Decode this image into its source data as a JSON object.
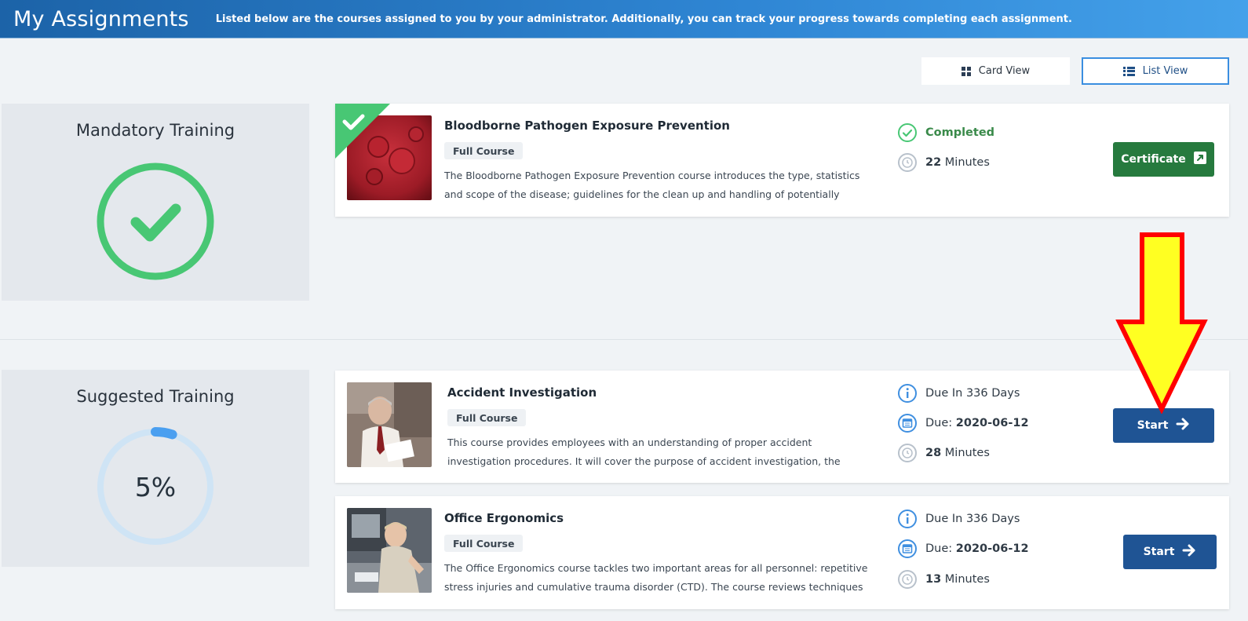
{
  "header": {
    "title": "My Assignments",
    "description": "Listed below are the courses assigned to you by your administrator. Additionally, you can track your progress towards completing each assignment."
  },
  "view_toggle": {
    "card_label": "Card View",
    "list_label": "List View",
    "active": "List View"
  },
  "colors": {
    "header_start": "#1c63a8",
    "header_end": "#44a1ea",
    "completed_green": "#48c774",
    "progress_blue": "#4a9ff0",
    "progress_track": "#cfe4f5",
    "primary_button": "#1f5494",
    "certificate_button": "#267a3e",
    "overlay_arrow_fill": "#ffff22",
    "overlay_arrow_stroke": "#ff0000"
  },
  "sections": [
    {
      "title": "Mandatory Training",
      "status_icon": "check-circle-icon",
      "progress_percent": 100,
      "courses": [
        {
          "title": "Bloodborne Pathogen Exposure Prevention",
          "tag": "Full Course",
          "description": "The Bloodborne Pathogen Exposure Prevention course introduces the type, statistics and scope of the disease; guidelines for the clean up and handling of potentially infectious...",
          "status": "Completed",
          "duration_value": "22",
          "duration_unit": "Minutes",
          "action_label": "Certificate",
          "thumbnail": "blood-cells-thumbnail"
        }
      ]
    },
    {
      "title": "Suggested Training",
      "progress_percent": 5,
      "progress_label": "5%",
      "courses": [
        {
          "title": "Accident Investigation",
          "tag": "Full Course",
          "description": "This course provides employees with an understanding of proper accident investigation procedures. It will cover the purpose of accident investigation, the process for accident...",
          "due_in": "Due In 336 Days",
          "due_label": "Due:",
          "due_date": "2020-06-12",
          "duration_value": "28",
          "duration_unit": "Minutes",
          "action_label": "Start",
          "thumbnail": "man-reading-thumbnail"
        },
        {
          "title": "Office Ergonomics",
          "tag": "Full Course",
          "description": "The Office Ergonomics course tackles two important areas for all personnel: repetitive stress injuries and cumulative trauma disorder (CTD). The course reviews techniques to...",
          "due_in": "Due In 336 Days",
          "due_label": "Due:",
          "due_date": "2020-06-12",
          "duration_value": "13",
          "duration_unit": "Minutes",
          "action_label": "Start",
          "thumbnail": "office-worker-thumbnail"
        }
      ]
    }
  ]
}
